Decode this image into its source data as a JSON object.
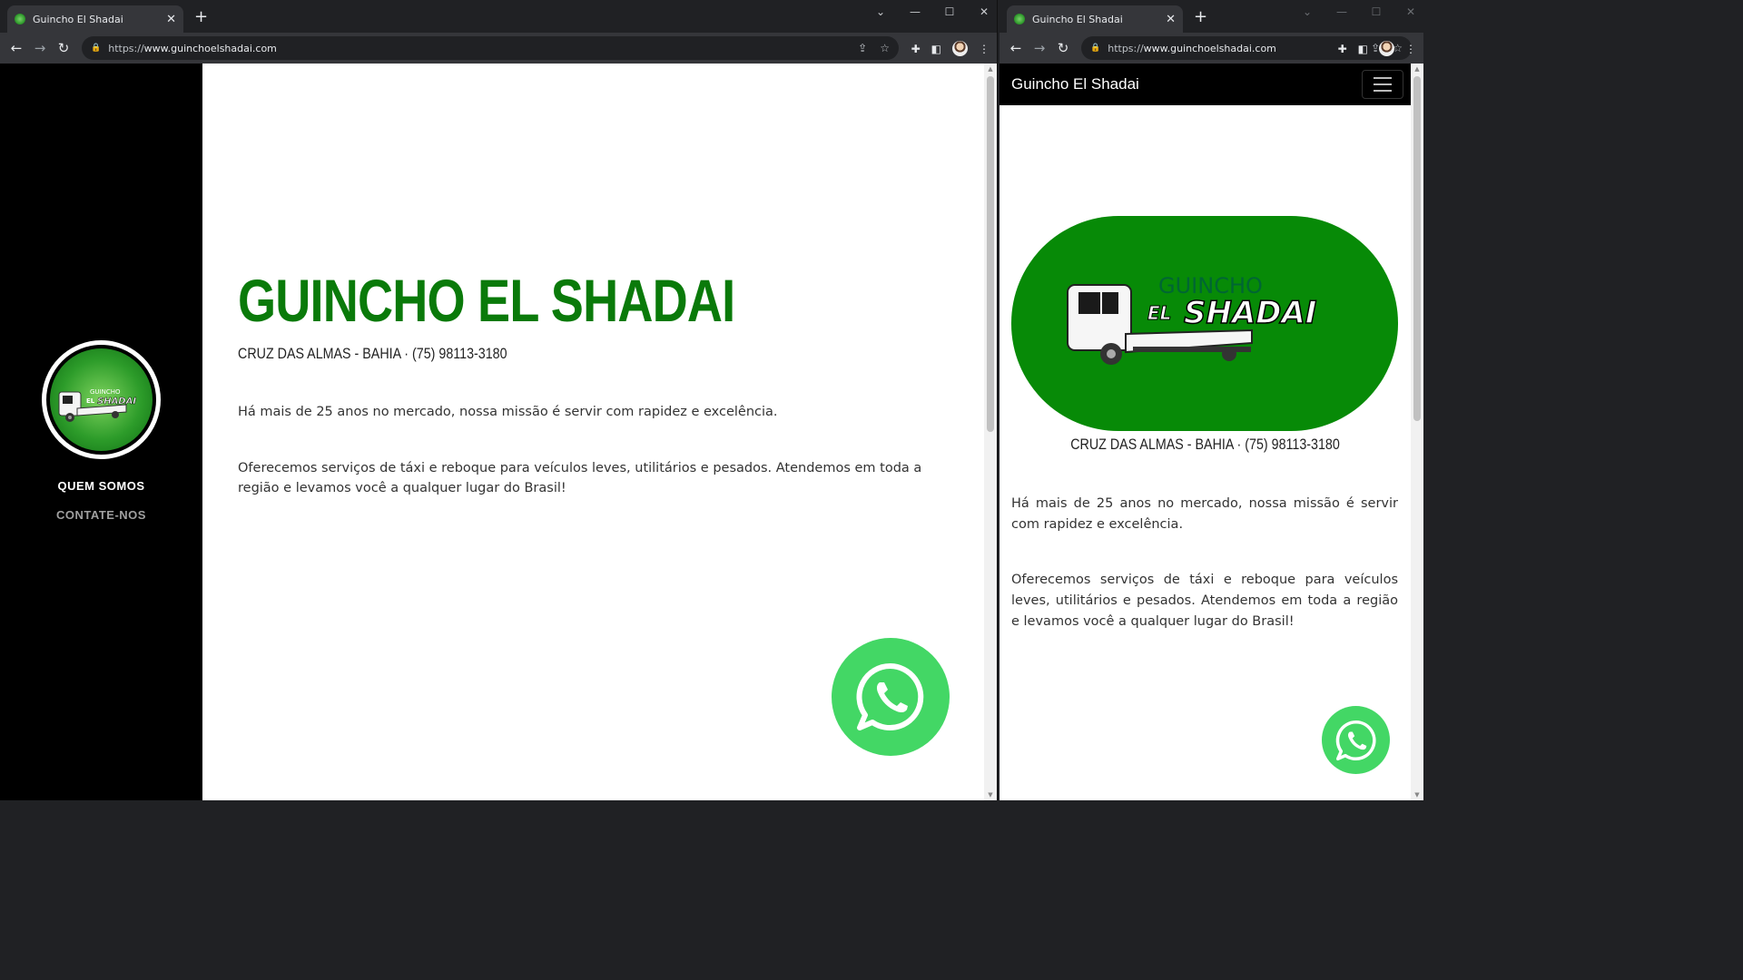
{
  "colors": {
    "brand_green": "#0a7a0a",
    "whatsapp_green": "#43d765",
    "logo_green": "#078a07"
  },
  "browser": {
    "tab_title": "Guincho El Shadai",
    "url_prefix": "https://",
    "url_domain": "www.guinchoelshadai.com"
  },
  "desktop_page": {
    "nav": {
      "item_1": "QUEM SOMOS",
      "item_2": "CONTATE-NOS"
    },
    "logo_text_top": "GUINCHO",
    "logo_text_el": "EL",
    "logo_text_shadai": "SHADAI",
    "title": "GUINCHO EL SHADAI",
    "subtitle": "CRUZ DAS ALMAS - BAHIA · (75) 98113-3180",
    "paragraph_1": "Há mais de 25 anos no mercado, nossa missão é servir com rapidez e excelência.",
    "paragraph_2": "Oferecemos serviços de táxi e reboque para veículos leves, utilitários e pesados. Atendemos em toda a região e levamos você a qualquer lugar do Brasil!"
  },
  "mobile_page": {
    "brand": "Guincho El Shadai",
    "logo_text_top": "GUINCHO",
    "logo_text_el": "EL",
    "logo_text_shadai": "SHADAI",
    "subtitle": "CRUZ DAS ALMAS - BAHIA · (75) 98113-3180",
    "paragraph_1": "Há mais de 25 anos no mercado, nossa missão é servir com rapidez e excelência.",
    "paragraph_2": "Oferecemos serviços de táxi e reboque para veículos leves, utilitários e pesados. Atendemos em toda a região e levamos você a qualquer lugar do Brasil!"
  }
}
